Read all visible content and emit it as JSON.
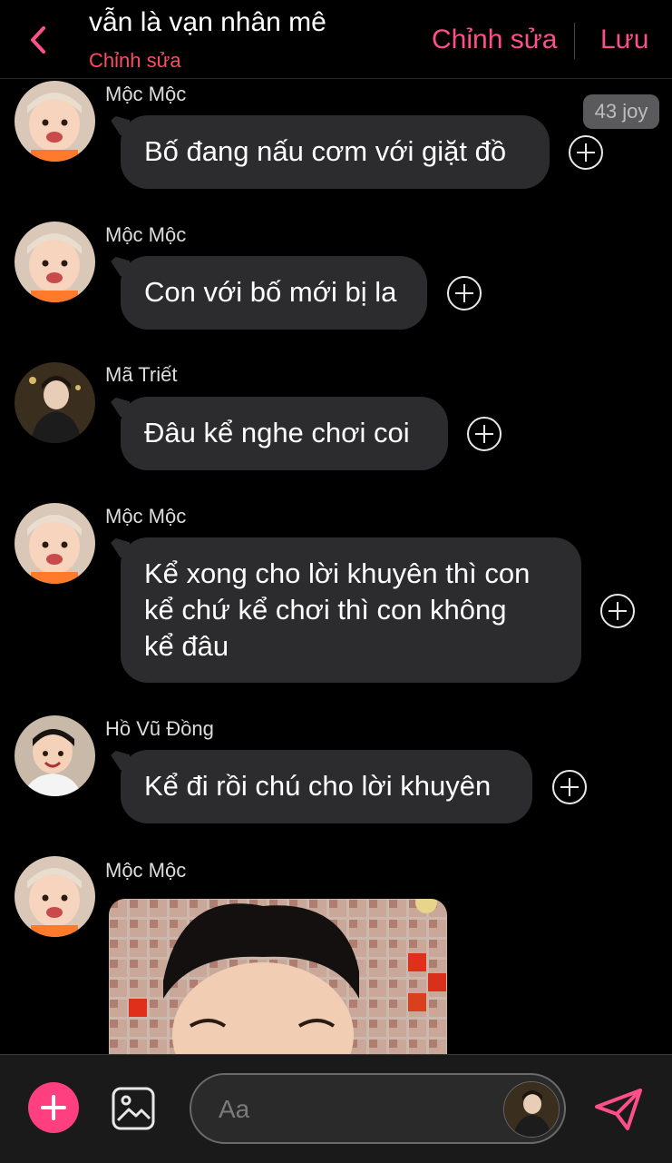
{
  "header": {
    "title": "vẫn là vạn nhân mê",
    "subtitle": "Chỉnh sửa",
    "edit_label": "Chỉnh sửa",
    "save_label": "Lưu"
  },
  "joy_badge": "43 joy",
  "messages": [
    {
      "sender": "Mộc Mộc",
      "text": "Bố đang nấu cơm với giặt đồ"
    },
    {
      "sender": "Mộc Mộc",
      "text": "Con với bố mới bị la"
    },
    {
      "sender": "Mã Triết",
      "text": "Đâu kể nghe chơi coi"
    },
    {
      "sender": "Mộc Mộc",
      "lines": [
        "Kể xong cho lời khuyên thì con",
        "kể chứ kể chơi thì con không",
        "kể đâu"
      ]
    },
    {
      "sender": "Hồ Vũ Đồng",
      "text": "Kể đi rồi chú cho lời khuyên"
    },
    {
      "sender": "Mộc Mộc",
      "image": "photo of a smiling boy"
    }
  ],
  "composer": {
    "placeholder": "Aa"
  },
  "colors": {
    "accent": "#ff4f8b",
    "bubble": "#2c2c2e",
    "background": "#000000"
  }
}
